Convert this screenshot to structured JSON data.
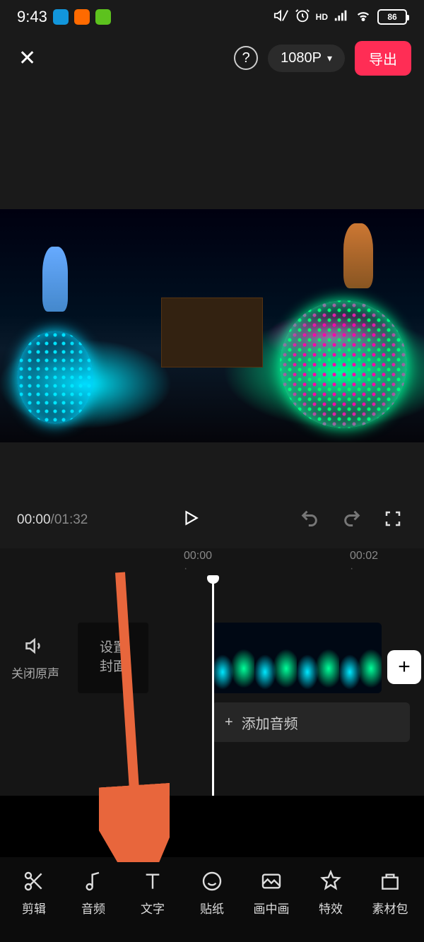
{
  "status": {
    "time": "9:43",
    "battery": "86",
    "hd_label": "HD"
  },
  "toolbar": {
    "resolution": "1080P",
    "export": "导出"
  },
  "controls": {
    "current_time": "00:00",
    "total_time": "01:32"
  },
  "ruler": {
    "t0": "00:00",
    "t1": "00:02"
  },
  "timeline": {
    "mute_label": "关闭原声",
    "cover_label": "设置\n封面",
    "add_audio": "添加音频"
  },
  "tabs": [
    {
      "label": "剪辑",
      "icon": "scissors"
    },
    {
      "label": "音频",
      "icon": "music"
    },
    {
      "label": "文字",
      "icon": "text"
    },
    {
      "label": "贴纸",
      "icon": "sticker"
    },
    {
      "label": "画中画",
      "icon": "pip"
    },
    {
      "label": "特效",
      "icon": "effect"
    },
    {
      "label": "素材包",
      "icon": "package"
    }
  ]
}
